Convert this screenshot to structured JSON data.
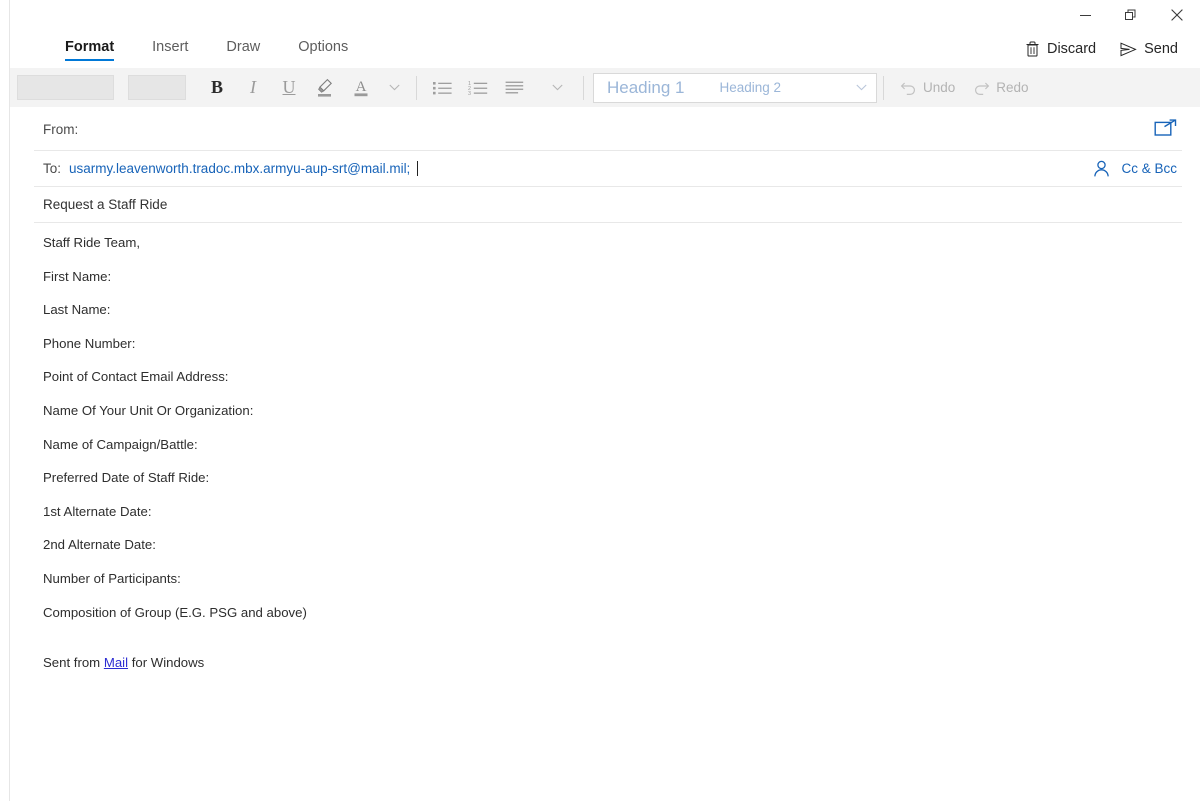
{
  "window": {
    "caption_buttons": [
      {
        "name": "minimize",
        "label": "Minimize"
      },
      {
        "name": "maximize",
        "label": "Restore"
      },
      {
        "name": "close",
        "label": "Close"
      }
    ]
  },
  "ribbon": {
    "tabs": [
      {
        "label": "Format",
        "active": true
      },
      {
        "label": "Insert",
        "active": false
      },
      {
        "label": "Draw",
        "active": false
      },
      {
        "label": "Options",
        "active": false
      }
    ],
    "actions": [
      {
        "label": "Discard",
        "icon": "trash-icon"
      },
      {
        "label": "Send",
        "icon": "send-icon"
      }
    ]
  },
  "toolbar": {
    "font_name_value": "",
    "font_size_value": "",
    "bold_label": "B",
    "italic_label": "I",
    "underline_label": "U",
    "highlight_icon": "highlighter-icon",
    "fontcolor_label": "A",
    "more_font_icon": "chevron-down-icon",
    "bullets_icon": "bulleted-list-icon",
    "numbering_icon": "numbered-list-icon",
    "paragraph_icon": "align-left-icon",
    "more_para_icon": "chevron-down-icon",
    "styles": [
      {
        "label": "Heading 1"
      },
      {
        "label": "Heading 2"
      }
    ],
    "styles_more_icon": "chevron-down-icon",
    "undo_label": "Undo",
    "redo_label": "Redo"
  },
  "compose": {
    "from_label": "From:",
    "from_value": "",
    "expand_icon": "popout-icon",
    "to_label": "To:",
    "to_value": "usarmy.leavenworth.tradoc.mbx.armyu-aup-srt@mail.mil;",
    "person_icon": "person-icon",
    "ccbcc_label": "Cc & Bcc",
    "subject_value": "Request a Staff Ride"
  },
  "body": {
    "lines": [
      "Staff Ride Team,",
      "First Name:",
      "Last Name:",
      "Phone Number:",
      "Point of Contact Email Address:",
      "Name Of Your Unit Or Organization:",
      "Name of Campaign/Battle:",
      "Preferred Date of Staff Ride:",
      "1st Alternate Date:",
      "2nd Alternate Date:",
      "Number of Participants:",
      "Composition of Group (E.G. PSG and above)"
    ],
    "signature_prefix": "Sent from ",
    "signature_link": "Mail",
    "signature_suffix": " for Windows"
  },
  "colors": {
    "accent": "#0078d7",
    "link": "#1763b8",
    "signature_link": "#2d2dd2",
    "toolbar_bg": "#f3f3f3",
    "style_text": "#9bb6d8"
  }
}
